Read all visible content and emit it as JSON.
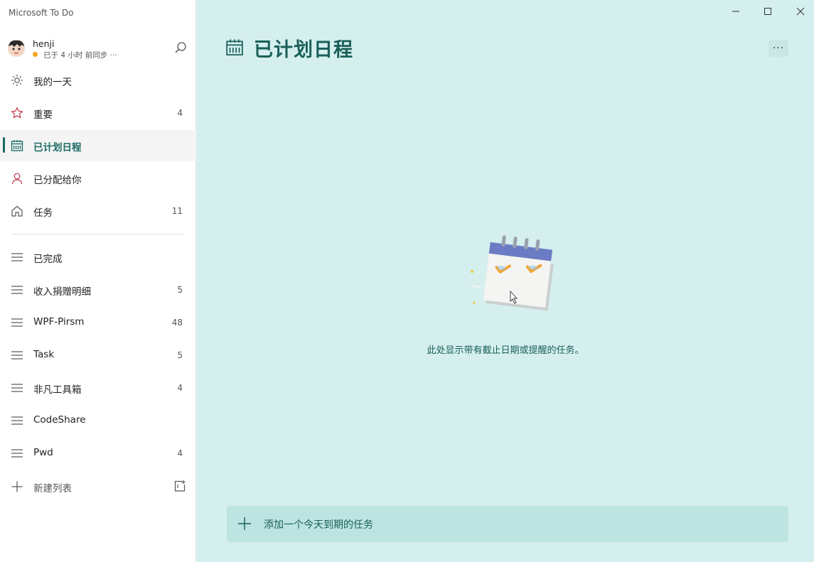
{
  "app": {
    "title": "Microsoft To Do"
  },
  "profile": {
    "name": "henji",
    "sync_status": "已于 4 小时 前同步 ···"
  },
  "sidebar": {
    "smart_lists": [
      {
        "label": "我的一天",
        "count": "",
        "icon": "sun-icon"
      },
      {
        "label": "重要",
        "count": "4",
        "icon": "star-icon"
      },
      {
        "label": "已计划日程",
        "count": "",
        "icon": "calendar-icon",
        "active": true
      },
      {
        "label": "已分配给你",
        "count": "",
        "icon": "person-icon"
      },
      {
        "label": "任务",
        "count": "11",
        "icon": "home-icon"
      }
    ],
    "lists": [
      {
        "label": "已完成",
        "count": ""
      },
      {
        "label": "收入捐赠明细",
        "count": "5"
      },
      {
        "label": "WPF-Pirsm",
        "count": "48"
      },
      {
        "label": "Task",
        "count": "5"
      },
      {
        "label": "非凡工具箱",
        "count": "4"
      },
      {
        "label": "CodeShare",
        "count": ""
      },
      {
        "label": "Pwd",
        "count": "4"
      }
    ],
    "new_list_label": "新建列表"
  },
  "main": {
    "title": "已计划日程",
    "more_label": "···",
    "empty_message": "此处显示带有截止日期或提醒的任务。",
    "add_task_label": "添加一个今天到期的任务"
  },
  "colors": {
    "accent": "#1a6a63",
    "background": "#d4efee",
    "add_bar": "#bce4e1"
  }
}
